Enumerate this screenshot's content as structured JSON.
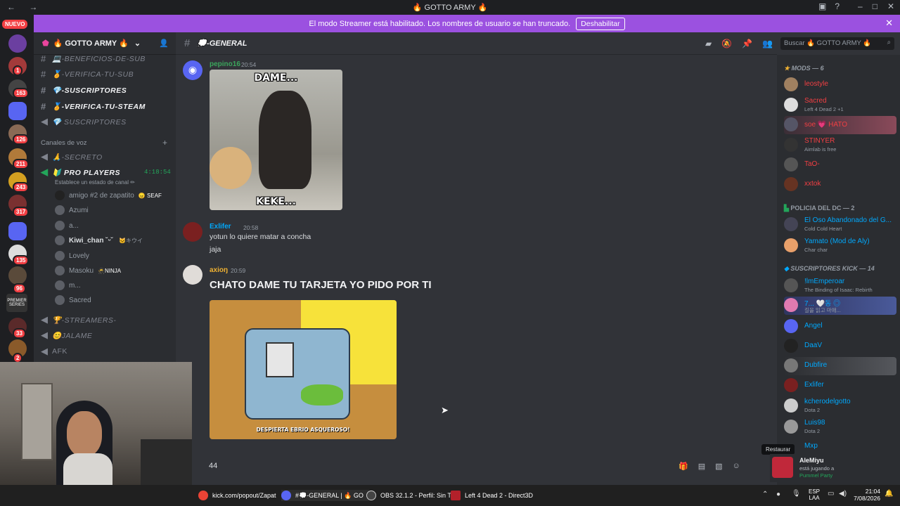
{
  "window": {
    "title": "🔥 GOTTO ARMY 🔥"
  },
  "banner": {
    "text": "El modo Streamer está habilitado. Los nombres de usuario se han truncado.",
    "button": "Deshabilitar"
  },
  "rail": {
    "nuevo": "NUEVO",
    "badges": [
      "1",
      "163",
      "126",
      "211",
      "243",
      "317",
      "135",
      "96",
      "33",
      "2"
    ],
    "premier": "PREMIER SERIES"
  },
  "server": {
    "name": "🔥 GOTTO ARMY 🔥"
  },
  "channels": {
    "text": [
      {
        "icon": "#",
        "label": "💻-BENEFICIOS-DE-SUB",
        "bold": false
      },
      {
        "icon": "#",
        "label": "🏅-VERIFICA-TU-SUB",
        "bold": false
      },
      {
        "icon": "#",
        "label": "💎-SUSCRIPTORES",
        "bold": true
      },
      {
        "icon": "#",
        "label": "🏅-VERIFICA-TU-STEAM",
        "bold": true
      },
      {
        "icon": "🔊",
        "label": "💎 SUSCRIPTORES",
        "bold": false
      }
    ],
    "voice_header": "Canales de voz",
    "voice": [
      {
        "label": "🙏-SECRETO"
      },
      {
        "label": "🔰 PRO PLAYERS",
        "time": "4:18:54",
        "status": "Establece un estado de canal ✏"
      }
    ],
    "voice_users": [
      "amigo #2 de zapatito",
      "Azumi",
      "a...",
      "Kiwi_chan ˘ᵕ˘",
      "Lovely",
      "Masoku",
      "m...",
      "Sacred"
    ],
    "voice_tags": {
      "amigo": "😠 SEAF",
      "kiwi": "🐱キウイ",
      "masoku": "🥷NINJA"
    },
    "lower": [
      {
        "label": "🏆-STREAMERS-"
      },
      {
        "label": "😊JALAME"
      },
      {
        "label": "AFK"
      }
    ]
  },
  "chat": {
    "channel": "💭-GENERAL",
    "messages": [
      {
        "author": "pepino16",
        "time": "20:54",
        "gif_top": "DAME...",
        "gif_bottom": "KEKE..."
      },
      {
        "author": "Exlifer",
        "time": "20:58",
        "lines": [
          "yotun lo quiere matar a concha",
          "jaja"
        ]
      },
      {
        "author": "axioŋ",
        "time": "20:59",
        "heading": "CHATO DAME TU TARJETA YO PIDO POR TI",
        "gif_caption": "DESPIERTA EBRIO ASQUEROSO!"
      }
    ],
    "input_value": "44",
    "search_placeholder": "Buscar 🔥 GOTTO ARMY 🔥"
  },
  "members": {
    "groups": [
      {
        "title": "MODS — 6",
        "items": [
          {
            "name": "leostyle",
            "status": ""
          },
          {
            "name": "Sacred",
            "status": "Left 4 Dead 2 +1"
          },
          {
            "name": "soe 💗 HATO",
            "status": ""
          },
          {
            "name": "STINYER",
            "status": "Aimlab is free"
          },
          {
            "name": "TaO-",
            "status": ""
          },
          {
            "name": "xxtok",
            "status": ""
          }
        ]
      },
      {
        "title": "POLICIA DEL DC — 2",
        "items": [
          {
            "name": "El Oso Abandonado del G...",
            "status": "Cold Cold Heart"
          },
          {
            "name": "Yamato (Mod de Aly)",
            "status": "Char char"
          }
        ]
      },
      {
        "title": "SUSCRIPTORES KICK — 14",
        "items": [
          {
            "name": "!lmEmperoar",
            "status": "The Binding of Isaac: Rebirth"
          },
          {
            "name": "7... 🤍동 ◎",
            "status": "길을 읽고 마애..."
          },
          {
            "name": "Angel",
            "status": ""
          },
          {
            "name": "DaaV",
            "status": ""
          },
          {
            "name": "Dubfire",
            "status": ""
          },
          {
            "name": "Exlifer",
            "status": ""
          },
          {
            "name": "kcherodelgotto",
            "status": "Dota 2"
          },
          {
            "name": "Luis98",
            "status": "Dota 2"
          },
          {
            "name": "Mxp",
            "status": ""
          }
        ]
      }
    ],
    "tooltip": "Restaurar",
    "notif": {
      "name": "AleMiyu",
      "line1": "está jugando a",
      "line2": "Pummel Party"
    }
  },
  "taskbar": {
    "items": [
      "kick.com/popout/Zapat",
      "#💭-GENERAL | 🔥 GO",
      "OBS 32.1.2 - Perfil: Sin Tí",
      "Left 4 Dead 2 - Direct3D"
    ],
    "lang": "ESP",
    "lang2": "LAA",
    "time": "21:04",
    "date": "7/08/2026"
  },
  "colors": {
    "accent": "#9b51e0",
    "red": "#f23f43",
    "mod": "#f23f43",
    "blue": "#00a8fc",
    "green": "#23a55a",
    "gold": "#f0b232"
  }
}
